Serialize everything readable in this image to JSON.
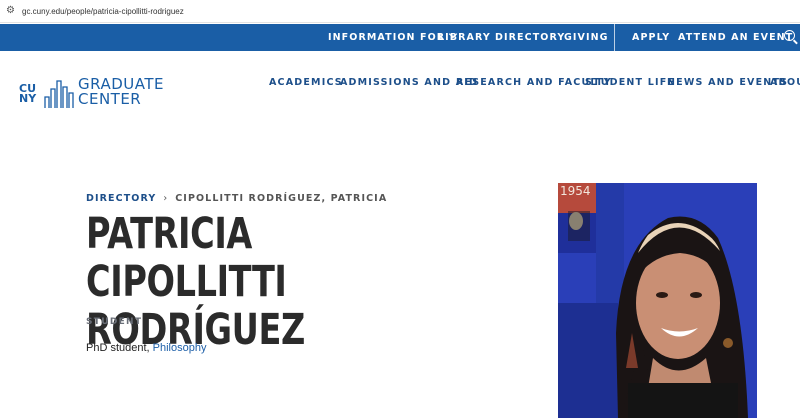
{
  "browser": {
    "url": "gc.cuny.edu/people/patricia-cipollitti-rodriguez"
  },
  "topbar": {
    "information_for": "INFORMATION FOR",
    "library": "LIBRARY",
    "directory": "DIRECTORY",
    "giving": "GIVING",
    "apply": "APPLY",
    "attend_event": "ATTEND AN EVENT"
  },
  "logo": {
    "cuny": "CU NY",
    "line1": "GRADUATE",
    "line2": "CENTER"
  },
  "nav": {
    "academics": "ACADEMICS",
    "admissions": "ADMISSIONS AND AID",
    "research": "RESEARCH AND FACULTY",
    "student_life": "STUDENT LIFE",
    "news": "NEWS AND EVENTS",
    "about": "ABOUT"
  },
  "breadcrumb": {
    "parent": "DIRECTORY",
    "current": "CIPOLLITTI RODRÍGUEZ, PATRICIA"
  },
  "profile": {
    "name_line1": "PATRICIA CIPOLLITTI",
    "name_line2": "RODRÍGUEZ",
    "role": "STUDENT",
    "desc_prefix": "PhD student, ",
    "program": "Philosophy",
    "photo_year": "1954"
  },
  "colors": {
    "brand": "#1a5ea6",
    "title": "#2b2b2b",
    "muted": "#6a6f78"
  }
}
